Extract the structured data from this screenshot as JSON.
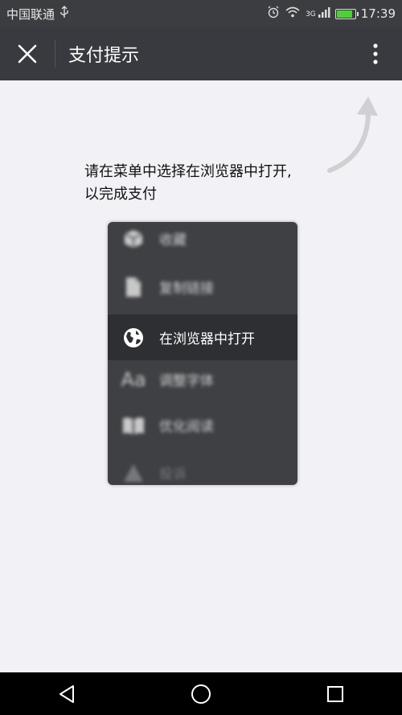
{
  "status_bar": {
    "carrier": "中国联通",
    "network": "3G",
    "time": "17:39",
    "battery_level": 0.9
  },
  "title_bar": {
    "title": "支付提示"
  },
  "instruction": {
    "line1": "请在菜单中选择在浏览器中打开,",
    "line2": "以完成支付"
  },
  "menu": {
    "items": [
      {
        "label": "收藏",
        "icon": "cube-icon"
      },
      {
        "label": "复制链接",
        "icon": "document-icon"
      },
      {
        "label": "在浏览器中打开",
        "icon": "globe-icon"
      },
      {
        "label": "调整字体",
        "icon": "font-size-icon"
      },
      {
        "label": "优化阅读",
        "icon": "book-icon"
      },
      {
        "label": "投诉",
        "icon": "warning-icon"
      }
    ]
  },
  "colors": {
    "status_bar": "#3c3d40",
    "title_bar": "#393a3f",
    "background": "#f2f1f6",
    "menu_bg": "#3f4044",
    "menu_active": "#2e2f33",
    "battery": "#4cd137"
  }
}
